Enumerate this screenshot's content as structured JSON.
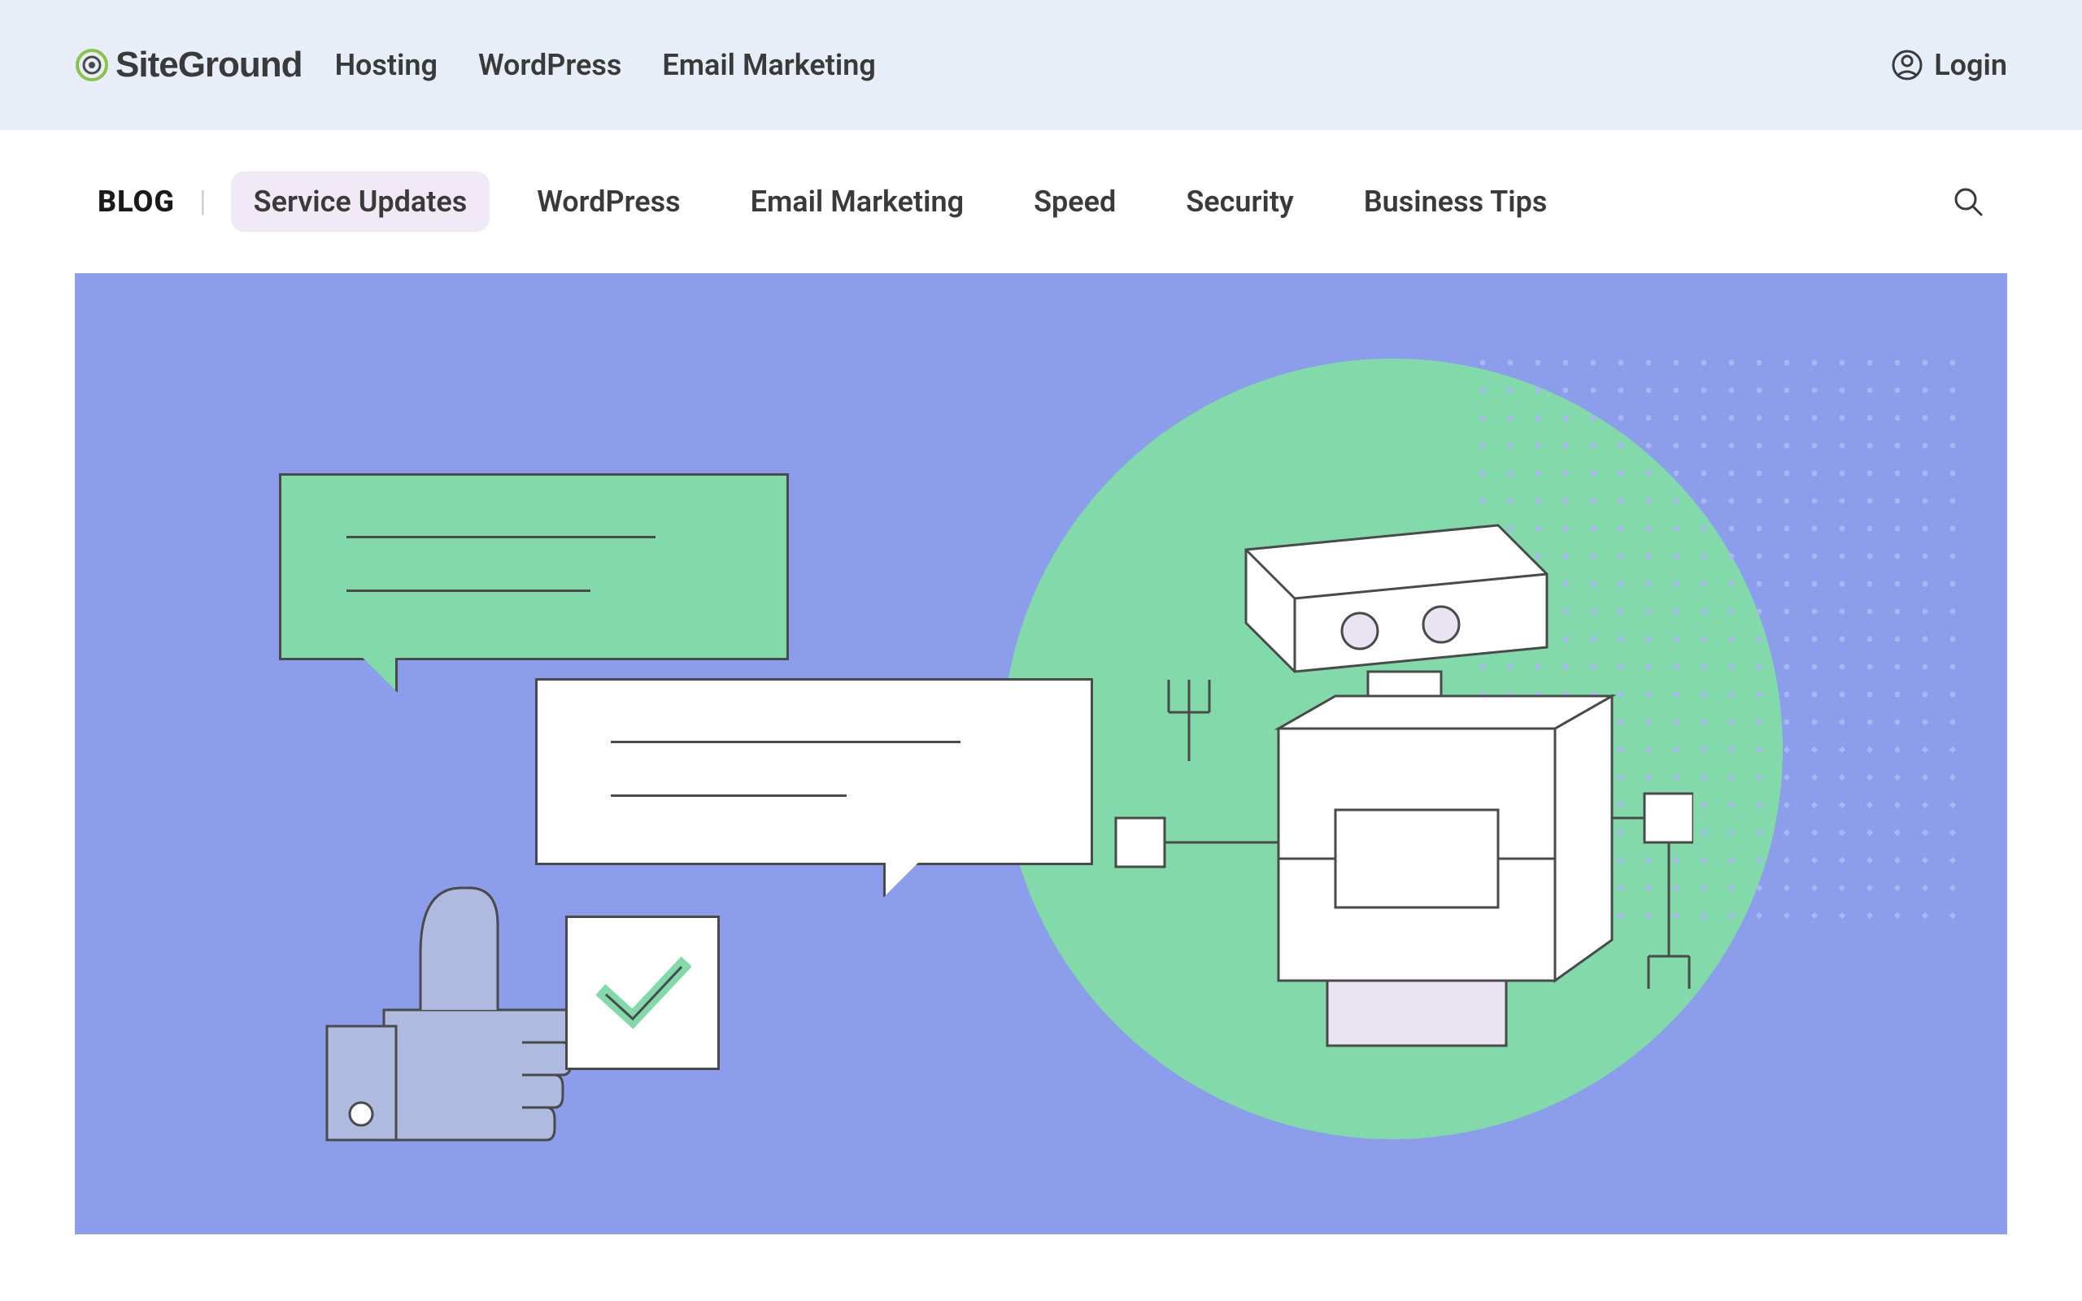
{
  "brand": {
    "name": "SiteGround"
  },
  "mainNav": {
    "items": [
      "Hosting",
      "WordPress",
      "Email Marketing"
    ]
  },
  "login": {
    "label": "Login"
  },
  "blogNav": {
    "label": "BLOG",
    "items": [
      {
        "label": "Service Updates",
        "active": true
      },
      {
        "label": "WordPress",
        "active": false
      },
      {
        "label": "Email Marketing",
        "active": false
      },
      {
        "label": "Speed",
        "active": false
      },
      {
        "label": "Security",
        "active": false
      },
      {
        "label": "Business Tips",
        "active": false
      }
    ]
  },
  "colors": {
    "headerBg": "#e7eef8",
    "heroBg": "#8b9deb",
    "accentGreen": "#82d9aa",
    "activePill": "#f2e9f7"
  }
}
